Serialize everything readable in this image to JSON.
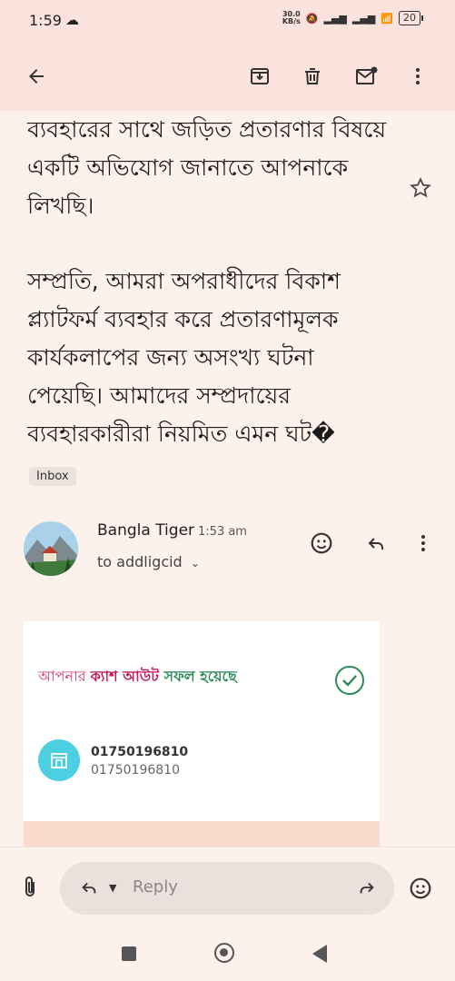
{
  "status": {
    "time": "1:59",
    "net_speed_top": "30.0",
    "net_speed_bottom": "KB/s",
    "battery": "20"
  },
  "appbar": {
    "icons": [
      "back-arrow-icon",
      "archive-icon",
      "delete-icon",
      "mark-unread-icon",
      "more-vert-icon"
    ]
  },
  "email": {
    "paragraph_1": "ব্যবহারের সাথে জড়িত প্রতারণার বিষয়ে একটি অভিযোগ জানাতে আপনাকে লিখছি।",
    "paragraph_2": "সম্প্রতি, আমরা অপরাধীদের বিকাশ প্ল্যাটফর্ম ব্যবহার করে প্রতারণামূলক কার্যকলাপের জন্য অসংখ্য ঘটনা পেয়েছি। আমাদের সম্প্রদায়ের ব্যবহারকারীরা নিয়মিত এমন ঘট�",
    "label_chip": "Inbox"
  },
  "message": {
    "sender": "Bangla Tiger",
    "time": "1:53 am",
    "recipient": "to addligcid"
  },
  "card": {
    "text_a": "আপনার ",
    "text_b": "ক্যাশ আউট ",
    "text_c": " সফল হয়েছে",
    "account_primary": "01750196810",
    "account_secondary": "01750196810"
  },
  "reply_bar": {
    "reply_label": "Reply"
  },
  "colors": {
    "header_bg": "#f9e3dc",
    "body_bg": "#fdf1ec",
    "accent_pink": "#c2185b",
    "accent_green": "#2e8b57"
  }
}
